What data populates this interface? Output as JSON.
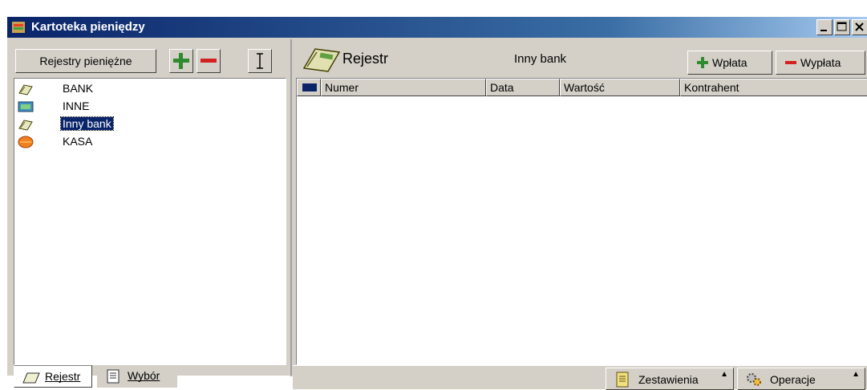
{
  "window": {
    "title": "Kartoteka pieniędzy"
  },
  "left": {
    "registry_button": "Rejestry pieniężne",
    "add_icon": "plus-icon",
    "remove_icon": "minus-icon",
    "cursor_icon": "text-cursor-icon",
    "items": [
      {
        "label": "BANK",
        "icon": "bank-book-icon",
        "selected": false
      },
      {
        "label": "INNE",
        "icon": "money-icon",
        "selected": false
      },
      {
        "label": "Inny bank",
        "icon": "bank-book-icon",
        "selected": true
      },
      {
        "label": "KASA",
        "icon": "cash-box-icon",
        "selected": false
      }
    ],
    "tabs": [
      {
        "label": "Rejestr",
        "active": true
      },
      {
        "label": "Wybór",
        "active": false
      }
    ]
  },
  "right": {
    "title": "Rejestr",
    "bank_name": "Inny bank",
    "wplata_label": "Wpłata",
    "wyplata_label": "Wypłata",
    "columns": [
      "Numer",
      "Data",
      "Wartość",
      "Kontrahent"
    ],
    "rows": [],
    "status": {
      "zestawienia_label": "Zestawienia",
      "operacje_label": "Operacje"
    }
  },
  "colors": {
    "title_bar": "#0a246a",
    "selection": "#0a246a",
    "plus": "#2e8b2e",
    "minus": "#d42020"
  }
}
